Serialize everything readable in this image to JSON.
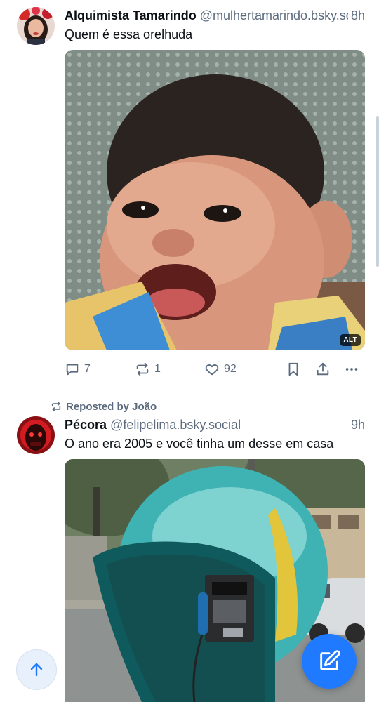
{
  "posts": [
    {
      "author_name": "Alquimista Tamarindo",
      "handle": "@mulhertamarindo.bsky.social",
      "time": "8h",
      "text": "Quem é essa orelhuda",
      "alt_badge": "ALT",
      "replies": "7",
      "reposts": "1",
      "likes": "92"
    },
    {
      "reposted_by": "Reposted by João",
      "author_name": "Pécora",
      "handle": "@felipelima.bsky.social",
      "time": "9h",
      "text": "O ano era 2005 e você tinha um desse em casa"
    }
  ],
  "colors": {
    "accent": "#1f7aff",
    "muted": "#5b6b7d",
    "divider": "#e3e8ee"
  },
  "icons": [
    "reply-icon",
    "repost-icon",
    "like-icon",
    "bookmark-icon",
    "share-icon",
    "more-icon",
    "compose-icon",
    "arrow-up-icon"
  ]
}
